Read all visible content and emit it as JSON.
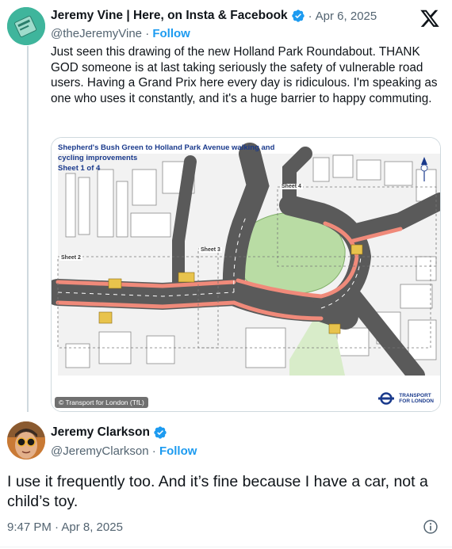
{
  "quoted_tweet": {
    "author_name": "Jeremy Vine | Here, on Insta & Facebook",
    "date": "Apr 6, 2025",
    "handle": "@theJeremyVine",
    "follow_label": "Follow",
    "text": "Just seen this drawing of the new Holland Park Roundabout. THANK GOD someone is at last taking seriously the safety of vulnerable road users. Having a Grand Prix here every day is ridiculous. I'm speaking as one who uses it constantly, and it's a huge barrier to happy commuting.",
    "media": {
      "title": "Shepherd's Bush Green to Holland Park Avenue walking and cycling improvements",
      "sheet": "Sheet 1 of 4",
      "sheet_labels": [
        "Sheet 2",
        "Sheet 3",
        "Sheet 4"
      ],
      "credit": "© Transport for London (TfL)",
      "logo_text_1": "TRANSPORT",
      "logo_text_2": "FOR LONDON"
    }
  },
  "reply_tweet": {
    "author_name": "Jeremy Clarkson",
    "handle": "@JeremyClarkson",
    "follow_label": "Follow",
    "text": "I use it frequently too. And it’s fine because I have a car, not a child’s toy.",
    "timestamp": "9:47 PM · Apr 8, 2025"
  },
  "colors": {
    "verified": "#1d9bf0",
    "follow": "#1d9bf0",
    "cycle_lane": "#f08a7a",
    "park": "#b9dca4",
    "road": "#5a5a5a"
  },
  "icons": [
    "x-logo-icon",
    "verified-badge-icon",
    "info-icon"
  ]
}
